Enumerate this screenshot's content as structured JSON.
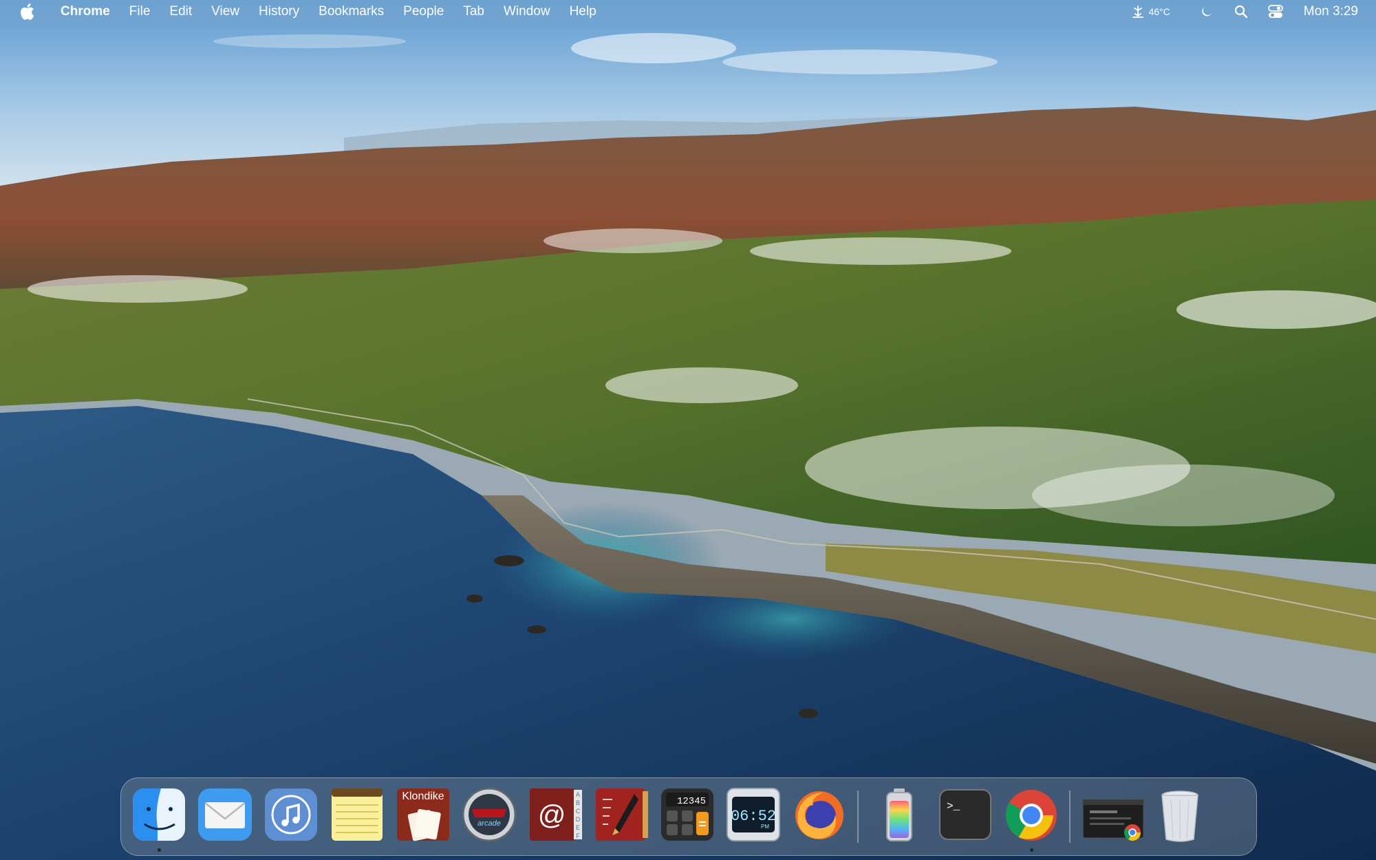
{
  "menubar": {
    "apple_icon": "apple-logo-icon",
    "app_name": "Chrome",
    "menus": [
      "File",
      "Edit",
      "View",
      "History",
      "Bookmarks",
      "People",
      "Tab",
      "Window",
      "Help"
    ],
    "weather": {
      "icon": "weather-station-icon",
      "temperature": "46°C"
    },
    "status_icons": [
      "moon-icon",
      "search-icon",
      "control-center-icon"
    ],
    "clock": "Mon 3:29"
  },
  "dock": {
    "items": [
      {
        "name": "finder",
        "running": true
      },
      {
        "name": "mail",
        "running": false
      },
      {
        "name": "music",
        "running": false
      },
      {
        "name": "notes",
        "running": false
      },
      {
        "name": "klondike",
        "label": "Klondike",
        "running": false
      },
      {
        "name": "pinball-arcade",
        "label": "arcade",
        "running": false
      },
      {
        "name": "address-book",
        "tabs": [
          "A",
          "B",
          "C",
          "D",
          "E",
          "F"
        ],
        "running": false
      },
      {
        "name": "quill-notebook",
        "running": false
      },
      {
        "name": "calculator",
        "display": "12345",
        "running": false
      },
      {
        "name": "digital-clock",
        "time": "06:52",
        "ampm": "PM",
        "running": false
      },
      {
        "name": "firefox",
        "running": false
      },
      {
        "name": "battery-app",
        "running": false
      },
      {
        "name": "terminal",
        "prompt": ">_",
        "running": false
      },
      {
        "name": "chrome",
        "running": true
      },
      {
        "name": "chrome-window-thumbnail",
        "running": false
      },
      {
        "name": "trash",
        "running": false
      }
    ]
  }
}
